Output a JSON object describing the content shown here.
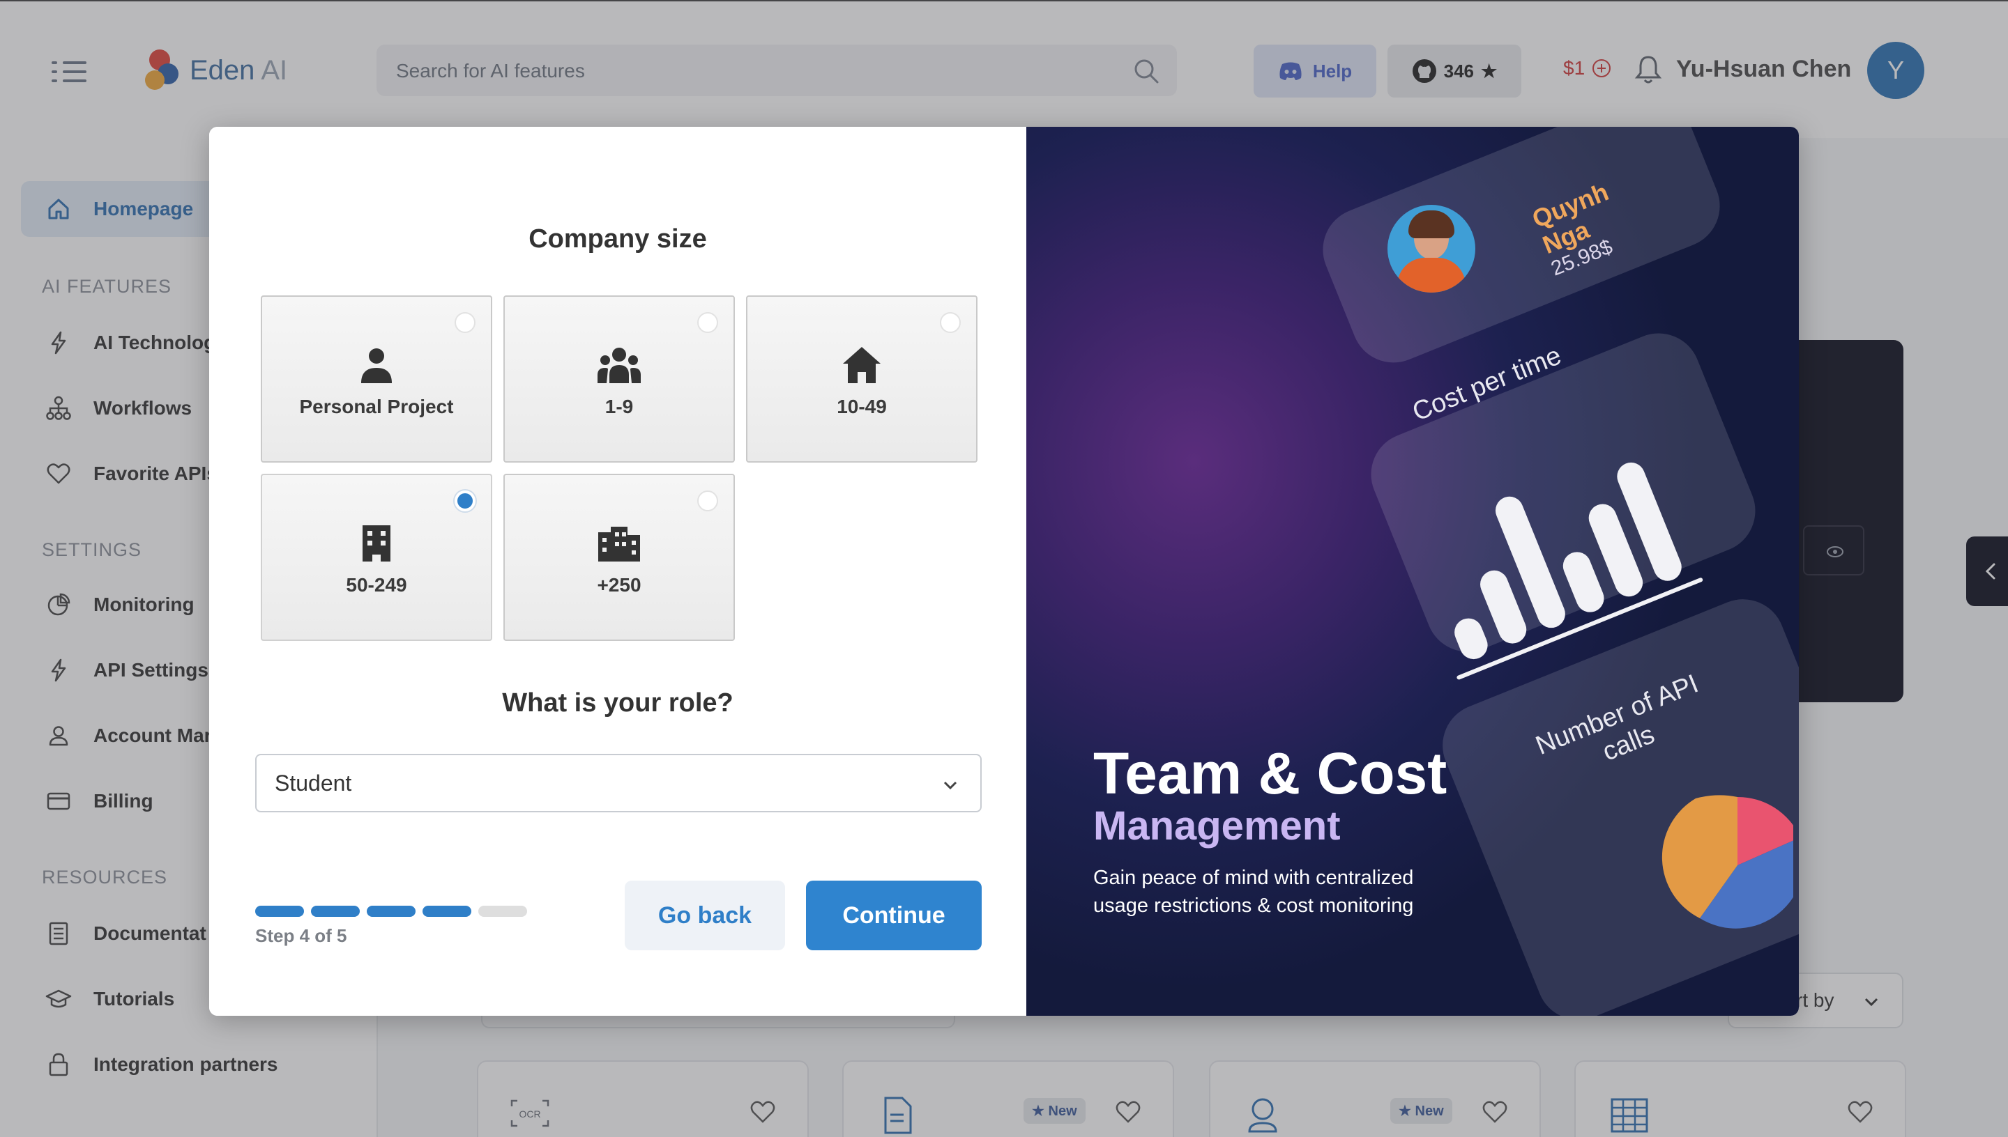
{
  "brand": {
    "name_main": "Eden",
    "name_sub": " AI"
  },
  "search": {
    "placeholder": "Search for AI features"
  },
  "header": {
    "help_label": "Help",
    "github_stars": "346",
    "credits": "$1",
    "user_name": "Yu-Hsuan Chen",
    "avatar_initial": "Y"
  },
  "sidebar": {
    "homepage": "Homepage",
    "section_ai": "AI FEATURES",
    "ai_items": [
      "AI Technolog",
      "Workflows",
      "Favorite APIs"
    ],
    "section_settings": "SETTINGS",
    "settings_items": [
      "Monitoring",
      "API Settings",
      "Account Mar",
      "Billing"
    ],
    "section_resources": "RESOURCES",
    "resource_items": [
      "Documentat",
      "Tutorials",
      "Integration partners"
    ]
  },
  "main": {
    "sort_label": "rt by",
    "new_badge": "New"
  },
  "modal": {
    "company_title": "Company size",
    "options": [
      {
        "label": "Personal Project",
        "icon": "person-icon",
        "selected": false
      },
      {
        "label": "1-9",
        "icon": "group-icon",
        "selected": false
      },
      {
        "label": "10-49",
        "icon": "house-icon",
        "selected": false
      },
      {
        "label": "50-249",
        "icon": "building-icon",
        "selected": true
      },
      {
        "label": "+250",
        "icon": "city-icon",
        "selected": false
      }
    ],
    "role_title": "What is your role?",
    "role_value": "Student",
    "step_text": "Step 4 of 5",
    "steps_total": 5,
    "steps_done": 4,
    "back_label": "Go back",
    "continue_label": "Continue",
    "promo": {
      "title": "Team & Cost",
      "subtitle": "Management",
      "description": "Gain peace of mind with centralized usage restrictions & cost monitoring",
      "card_name": "Quynh Nga",
      "card_amount": "25.98$",
      "card_cost": "Cost per time",
      "card_api": "Number of API calls"
    }
  },
  "colors": {
    "accent": "#2f84cf",
    "promo_bg": "#1d2150",
    "credits": "#d23b3b"
  }
}
